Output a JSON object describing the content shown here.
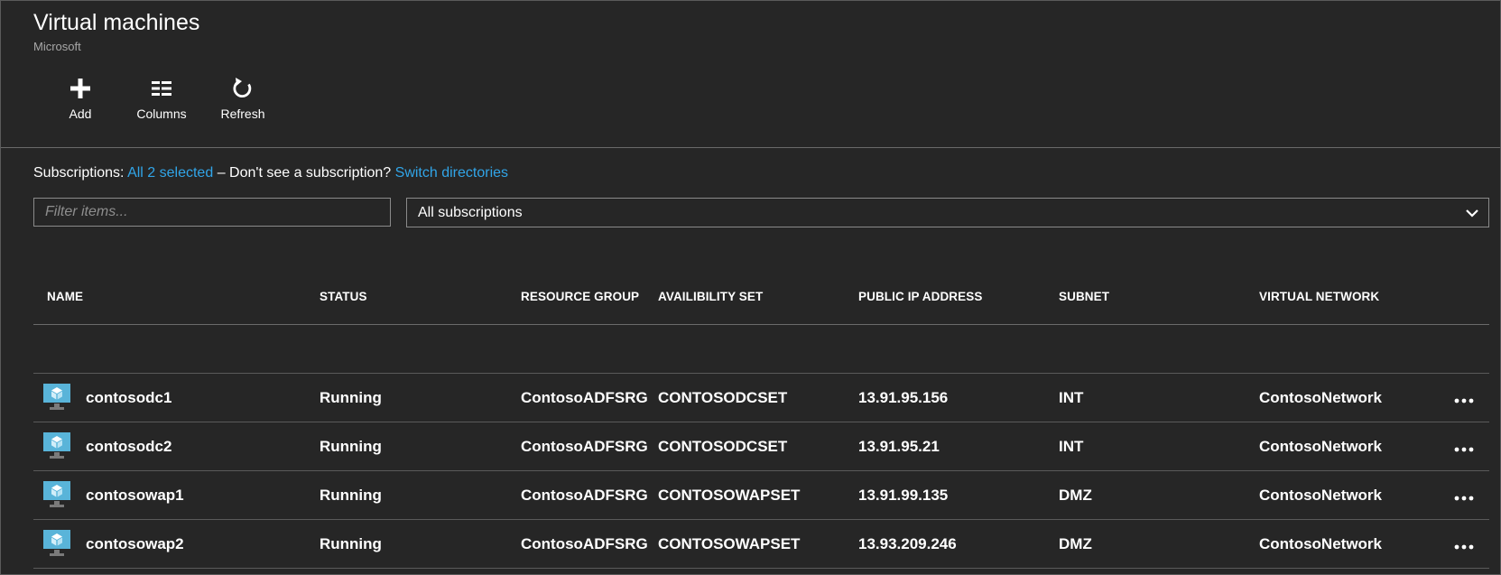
{
  "blade": {
    "title": "Virtual machines",
    "subtitle": "Microsoft"
  },
  "toolbar": {
    "add_label": "Add",
    "columns_label": "Columns",
    "refresh_label": "Refresh"
  },
  "subscriptions": {
    "label": "Subscriptions:",
    "selected_link": "All 2 selected",
    "prompt": " – Don't see a subscription? ",
    "switch_link": "Switch directories"
  },
  "filter": {
    "placeholder": "Filter items...",
    "value": ""
  },
  "subscription_select": {
    "selected": "All subscriptions"
  },
  "columns": [
    "NAME",
    "STATUS",
    "RESOURCE GROUP",
    "AVAILIBILITY SET",
    "PUBLIC IP ADDRESS",
    "SUBNET",
    "VIRTUAL NETWORK"
  ],
  "rows": [
    {
      "name": "contosodc1",
      "status": "Running",
      "resource_group": "ContosoADFSRG",
      "availability_set": "CONTOSODCSET",
      "public_ip": "13.91.95.156",
      "subnet": "INT",
      "virtual_network": "ContosoNetwork"
    },
    {
      "name": "contosodc2",
      "status": "Running",
      "resource_group": "ContosoADFSRG",
      "availability_set": "CONTOSODCSET",
      "public_ip": "13.91.95.21",
      "subnet": "INT",
      "virtual_network": "ContosoNetwork"
    },
    {
      "name": "contosowap1",
      "status": "Running",
      "resource_group": "ContosoADFSRG",
      "availability_set": "CONTOSOWAPSET",
      "public_ip": "13.91.99.135",
      "subnet": "DMZ",
      "virtual_network": "ContosoNetwork"
    },
    {
      "name": "contosowap2",
      "status": "Running",
      "resource_group": "ContosoADFSRG",
      "availability_set": "CONTOSOWAPSET",
      "public_ip": "13.93.209.246",
      "subnet": "DMZ",
      "virtual_network": "ContosoNetwork"
    }
  ],
  "icons": {
    "add": "plus-icon",
    "columns": "columns-icon",
    "refresh": "refresh-icon",
    "vm": "virtual-machine-icon",
    "more": "ellipsis-icon",
    "dropdown": "chevron-down-icon"
  },
  "colors": {
    "background": "#262626",
    "link": "#31a5e8",
    "vm_icon": "#59b4d9"
  }
}
